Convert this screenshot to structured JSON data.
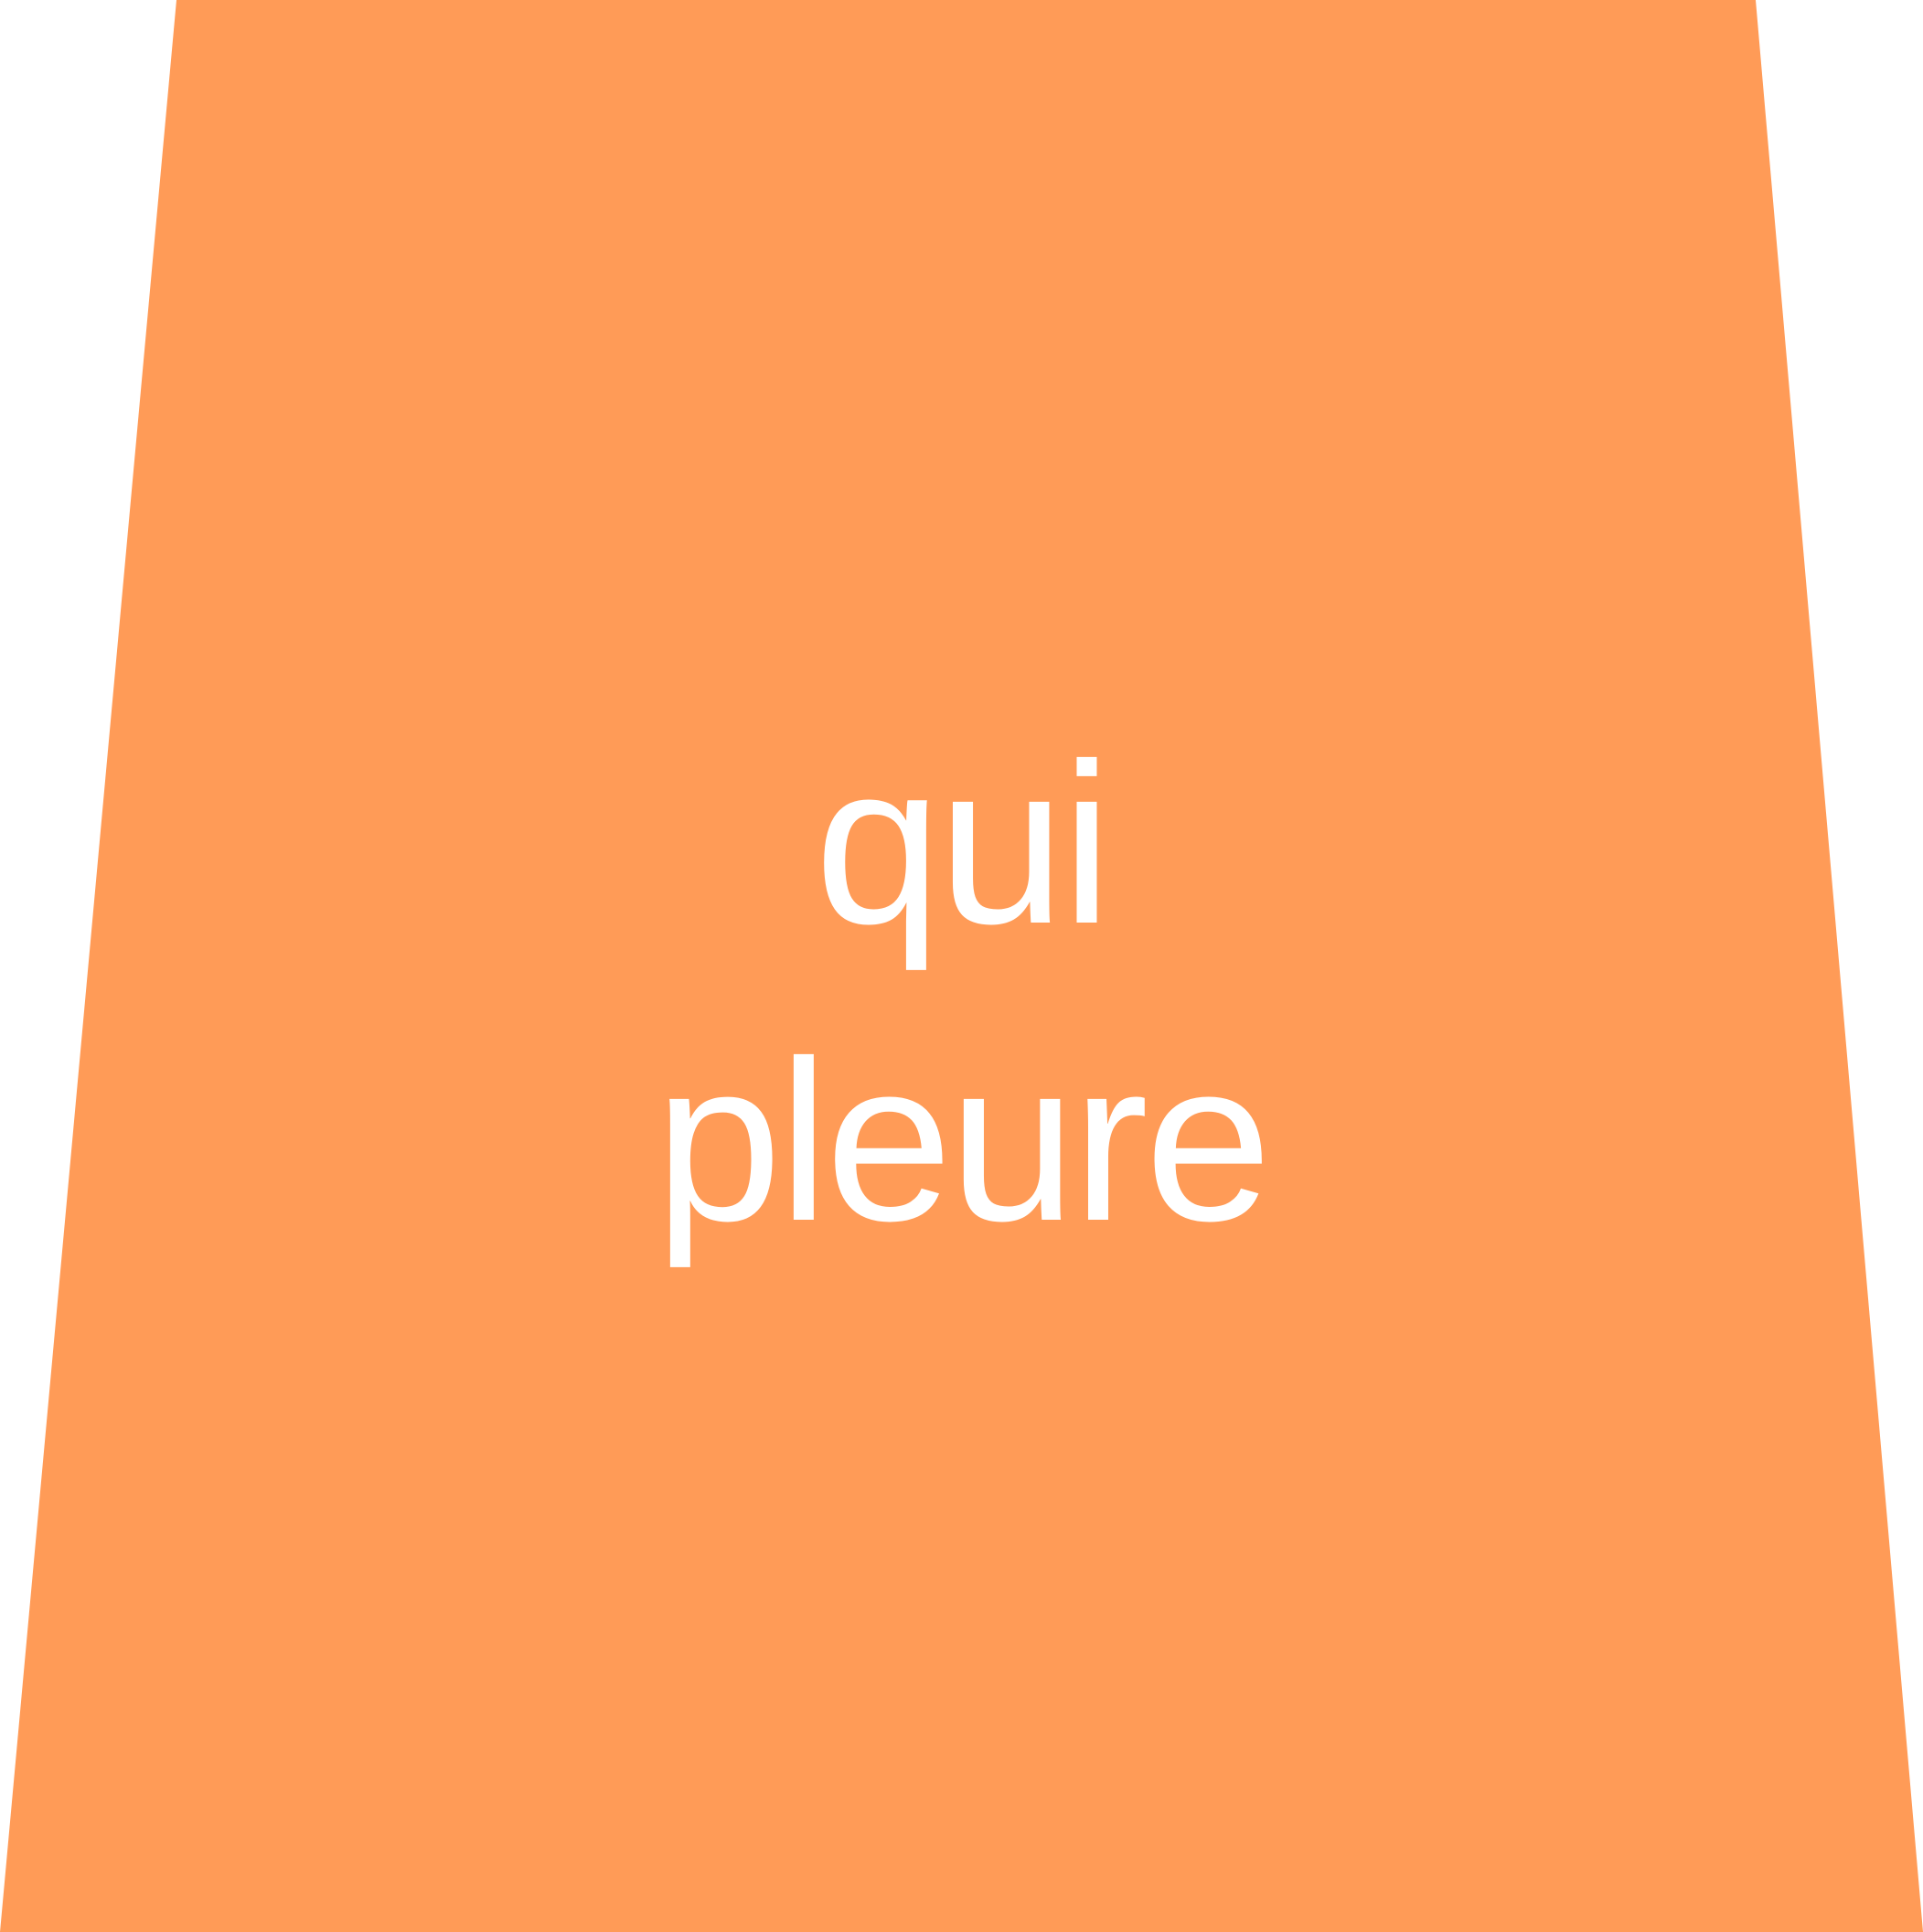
{
  "shape": {
    "fill": "#FF9B57"
  },
  "text": {
    "line1": "qui",
    "line2": "pleure",
    "color": "#FFFFFF"
  }
}
